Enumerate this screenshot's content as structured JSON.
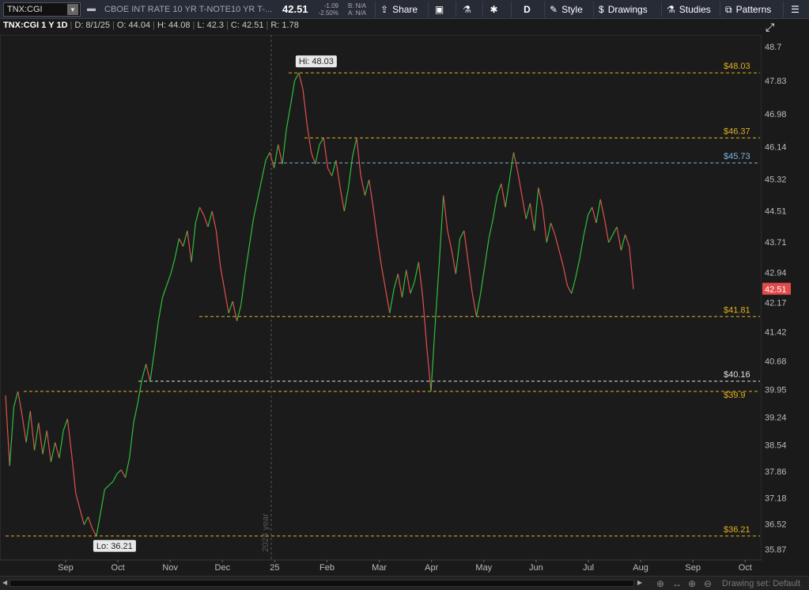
{
  "toolbar": {
    "symbol": "TNX:CGI",
    "description": "CBOE INT RATE 10 YR T-NOTE",
    "description_short": "10 YR T-...",
    "last": "42.51",
    "net_change": "-1.09",
    "pct_change": "-2.50%",
    "bid": "B: N/A",
    "ask": "A: N/A",
    "share_label": "Share",
    "period_label": "D",
    "style_label": "Style",
    "drawings_label": "Drawings",
    "studies_label": "Studies",
    "patterns_label": "Patterns",
    "icons": [
      "pin-icon",
      "share-icon",
      "notebook-icon",
      "flask-icon",
      "gear-icon",
      "drawing-icon",
      "studies-flask-icon",
      "patterns-icon",
      "menu-icon"
    ]
  },
  "infoline": {
    "symbol": "TNX:CGI 1 Y 1D",
    "date": "D: 8/1/25",
    "open": "O: 44.04",
    "high": "H: 44.08",
    "low": "L: 42.3",
    "close": "C: 42.51",
    "range": "R: 1.78"
  },
  "chart_data": {
    "type": "line",
    "x_axis_labels": [
      "Sep",
      "Oct",
      "Nov",
      "Dec",
      "25",
      "Feb",
      "Mar",
      "Apr",
      "May",
      "Jun",
      "Jul",
      "Aug",
      "Sep",
      "Oct"
    ],
    "y_axis_labels": [
      "48.7",
      "47.83",
      "46.98",
      "46.14",
      "45.32",
      "44.51",
      "43.71",
      "42.94",
      "42.17",
      "41.42",
      "40.68",
      "39.95",
      "39.24",
      "38.54",
      "37.86",
      "37.18",
      "36.52",
      "35.87"
    ],
    "ylim": [
      35.6,
      49.0
    ],
    "year_marker": "2024 year",
    "high_label": "Hi: 48.03",
    "low_label": "Lo: 36.21",
    "last_price_label": "42.51",
    "levels": [
      {
        "value": 48.03,
        "label": "$48.03",
        "color": "#e0b020"
      },
      {
        "value": 46.37,
        "label": "$46.37",
        "color": "#e0b020"
      },
      {
        "value": 45.73,
        "label": "$45.73",
        "color": "#7fb3e0"
      },
      {
        "value": 41.81,
        "label": "$41.81",
        "color": "#e0b020"
      },
      {
        "value": 40.16,
        "label": "$40.16",
        "color": "#e0e0e0"
      },
      {
        "value": 39.9,
        "label": "$39.9",
        "color": "#e0b020"
      },
      {
        "value": 36.21,
        "label": "$36.21",
        "color": "#e0b020"
      }
    ],
    "series": [
      {
        "values": [
          39.8,
          38.0,
          39.5,
          39.9,
          39.3,
          38.6,
          39.4,
          38.4,
          39.1,
          38.3,
          38.9,
          38.1,
          38.6,
          38.2,
          38.9,
          39.2,
          38.3,
          37.3,
          36.9,
          36.5,
          36.7,
          36.4,
          36.21,
          36.8,
          37.4,
          37.5,
          37.6,
          37.8,
          37.9,
          37.7,
          38.2,
          39.1,
          39.6,
          40.2,
          40.6,
          40.16,
          40.9,
          41.7,
          42.3,
          42.6,
          42.9,
          43.3,
          43.8,
          43.6,
          44.0,
          43.2,
          44.2,
          44.6,
          44.4,
          44.1,
          44.5,
          44.0,
          43.1,
          42.5,
          41.9,
          42.2,
          41.7,
          42.1,
          42.9,
          43.6,
          44.3,
          44.8,
          45.3,
          45.8,
          46.0,
          45.6,
          46.2,
          45.7,
          46.6,
          47.2,
          47.83,
          48.03,
          47.6,
          46.7,
          46.0,
          45.7,
          46.2,
          46.37,
          45.6,
          45.4,
          45.8,
          45.1,
          44.5,
          45.1,
          45.9,
          46.37,
          45.4,
          44.9,
          45.3,
          44.6,
          43.8,
          43.1,
          42.5,
          41.9,
          42.5,
          42.9,
          42.3,
          43.0,
          42.4,
          42.7,
          43.2,
          42.3,
          41.0,
          39.9,
          41.6,
          43.2,
          44.9,
          44.0,
          43.5,
          42.9,
          43.8,
          44.0,
          43.2,
          42.4,
          41.81,
          42.4,
          43.1,
          43.8,
          44.3,
          44.9,
          45.2,
          44.6,
          45.3,
          46.0,
          45.5,
          44.9,
          44.3,
          44.7,
          44.0,
          45.1,
          44.6,
          43.7,
          44.2,
          43.9,
          43.5,
          43.1,
          42.6,
          42.4,
          42.8,
          43.3,
          43.9,
          44.4,
          44.6,
          44.2,
          44.8,
          44.3,
          43.7,
          43.9,
          44.1,
          43.5,
          43.9,
          43.6,
          42.51
        ]
      }
    ]
  },
  "bottom": {
    "drawing_set": "Drawing set: Default"
  }
}
